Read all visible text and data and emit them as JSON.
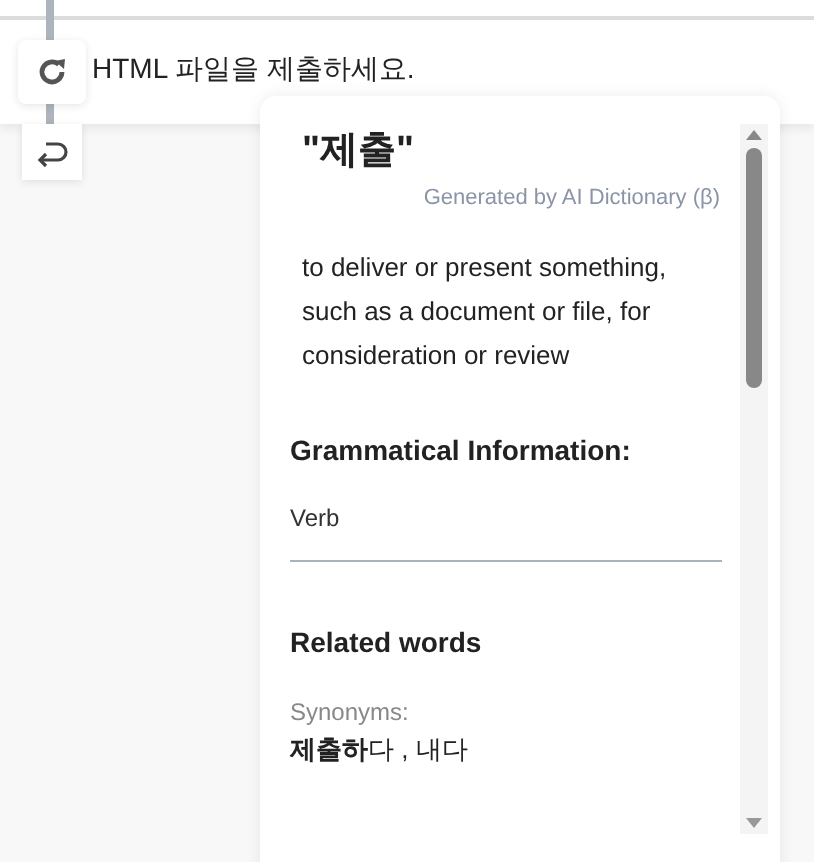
{
  "prompt": {
    "text": "HTML 파일을 제출하세요."
  },
  "popup": {
    "term": "\"제출\"",
    "source": "Generated by AI Dictionary (β)",
    "definition": "to deliver or present something, such as a document or file, for consideration or review",
    "grammar_heading": "Grammatical Information:",
    "part_of_speech": "Verb",
    "related_heading": "Related words",
    "synonyms_label": "Synonyms:",
    "synonyms": "**제출하**다 , 내다"
  }
}
